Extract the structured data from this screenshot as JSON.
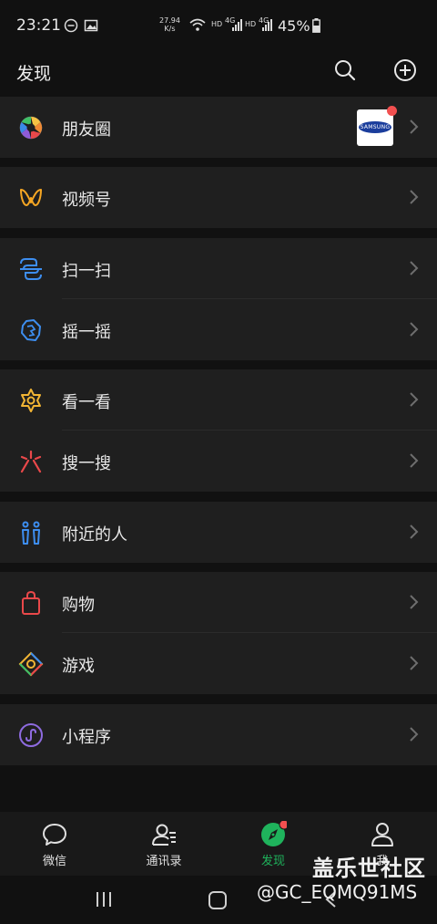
{
  "status_bar": {
    "time": "23:21",
    "net_speed_value": "27.94",
    "net_speed_unit": "K/s",
    "hd1": "HD",
    "sig1": "4G",
    "hd2": "HD",
    "sig2": "4G",
    "battery": "45%"
  },
  "header": {
    "title": "发现",
    "search_icon": "search-icon",
    "add_icon": "plus-circle-icon"
  },
  "groups": [
    {
      "items": [
        {
          "label": "朋友圈",
          "icon": "moments-icon",
          "thumbnail_text": "SAMSUNG",
          "has_badge": true
        }
      ]
    },
    {
      "items": [
        {
          "label": "视频号",
          "icon": "channels-icon"
        }
      ]
    },
    {
      "items": [
        {
          "label": "扫一扫",
          "icon": "scan-icon"
        },
        {
          "label": "摇一摇",
          "icon": "shake-icon"
        }
      ]
    },
    {
      "items": [
        {
          "label": "看一看",
          "icon": "top-stories-icon"
        },
        {
          "label": "搜一搜",
          "icon": "search-search-icon"
        }
      ]
    },
    {
      "items": [
        {
          "label": "附近的人",
          "icon": "people-nearby-icon"
        }
      ]
    },
    {
      "items": [
        {
          "label": "购物",
          "icon": "shopping-bag-icon"
        },
        {
          "label": "游戏",
          "icon": "games-icon"
        }
      ]
    },
    {
      "items": [
        {
          "label": "小程序",
          "icon": "mini-programs-icon"
        }
      ]
    }
  ],
  "tabbar": {
    "tabs": [
      {
        "label": "微信",
        "icon": "chat-bubble-icon",
        "active": false
      },
      {
        "label": "通讯录",
        "icon": "contacts-icon",
        "active": false
      },
      {
        "label": "发现",
        "icon": "discover-compass-icon",
        "active": true,
        "badge": true
      },
      {
        "label": "我",
        "icon": "me-person-icon",
        "active": false
      }
    ]
  },
  "watermark": {
    "line1": "盖乐世社区",
    "line2": "@GC_EQMQ91MS"
  },
  "colors": {
    "background": "#111111",
    "row_background": "#1f1f1f",
    "active_green": "#1fb35c",
    "badge_red": "#f25050"
  }
}
